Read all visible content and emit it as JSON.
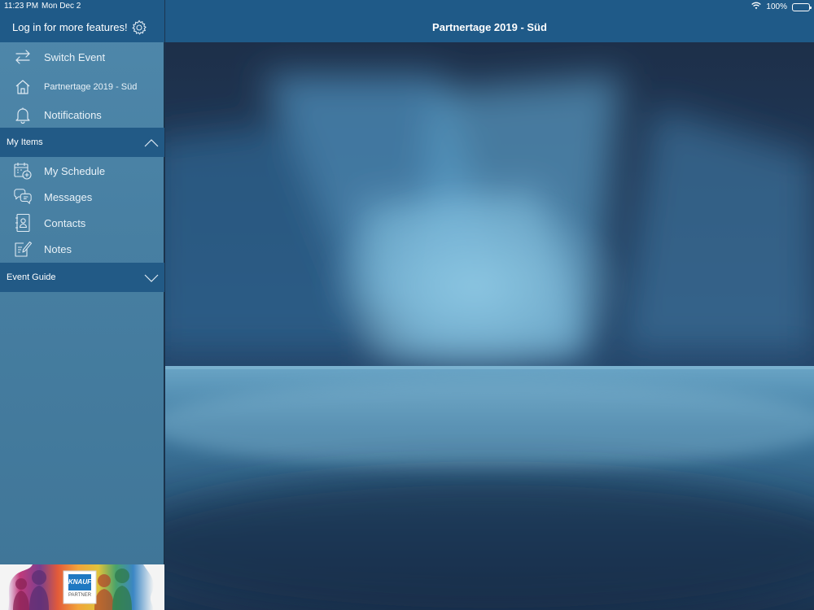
{
  "status_bar": {
    "time": "11:23 PM",
    "date": "Mon Dec 2",
    "battery": "100%",
    "battery_level": 1.0
  },
  "sidebar": {
    "login_text": "Log in for more features!",
    "settings_icon": "gear-icon",
    "top_items": [
      {
        "label": "Switch Event",
        "icon": "swap-arrows-icon"
      },
      {
        "label": "Partnertage 2019 - Süd",
        "icon": "home-icon"
      },
      {
        "label": "Notifications",
        "icon": "bell-icon"
      }
    ],
    "my_items": {
      "label": "My Items",
      "expanded": true,
      "items": [
        {
          "label": "My Schedule",
          "icon": "calendar-add-icon"
        },
        {
          "label": "Messages",
          "icon": "chat-bubbles-icon"
        },
        {
          "label": "Contacts",
          "icon": "contact-book-icon"
        },
        {
          "label": "Notes",
          "icon": "note-pencil-icon"
        }
      ]
    },
    "event_guide": {
      "label": "Event Guide",
      "expanded": false
    },
    "banner": {
      "logo_text": "KNAUF",
      "sub_text": "PARTNER"
    }
  },
  "main": {
    "title": "Partnertage 2019 - Süd"
  },
  "colors": {
    "header": "#1f5a88",
    "sidebar": "#4a82a5",
    "section": "#225a86",
    "stage": "#1b2f48"
  }
}
